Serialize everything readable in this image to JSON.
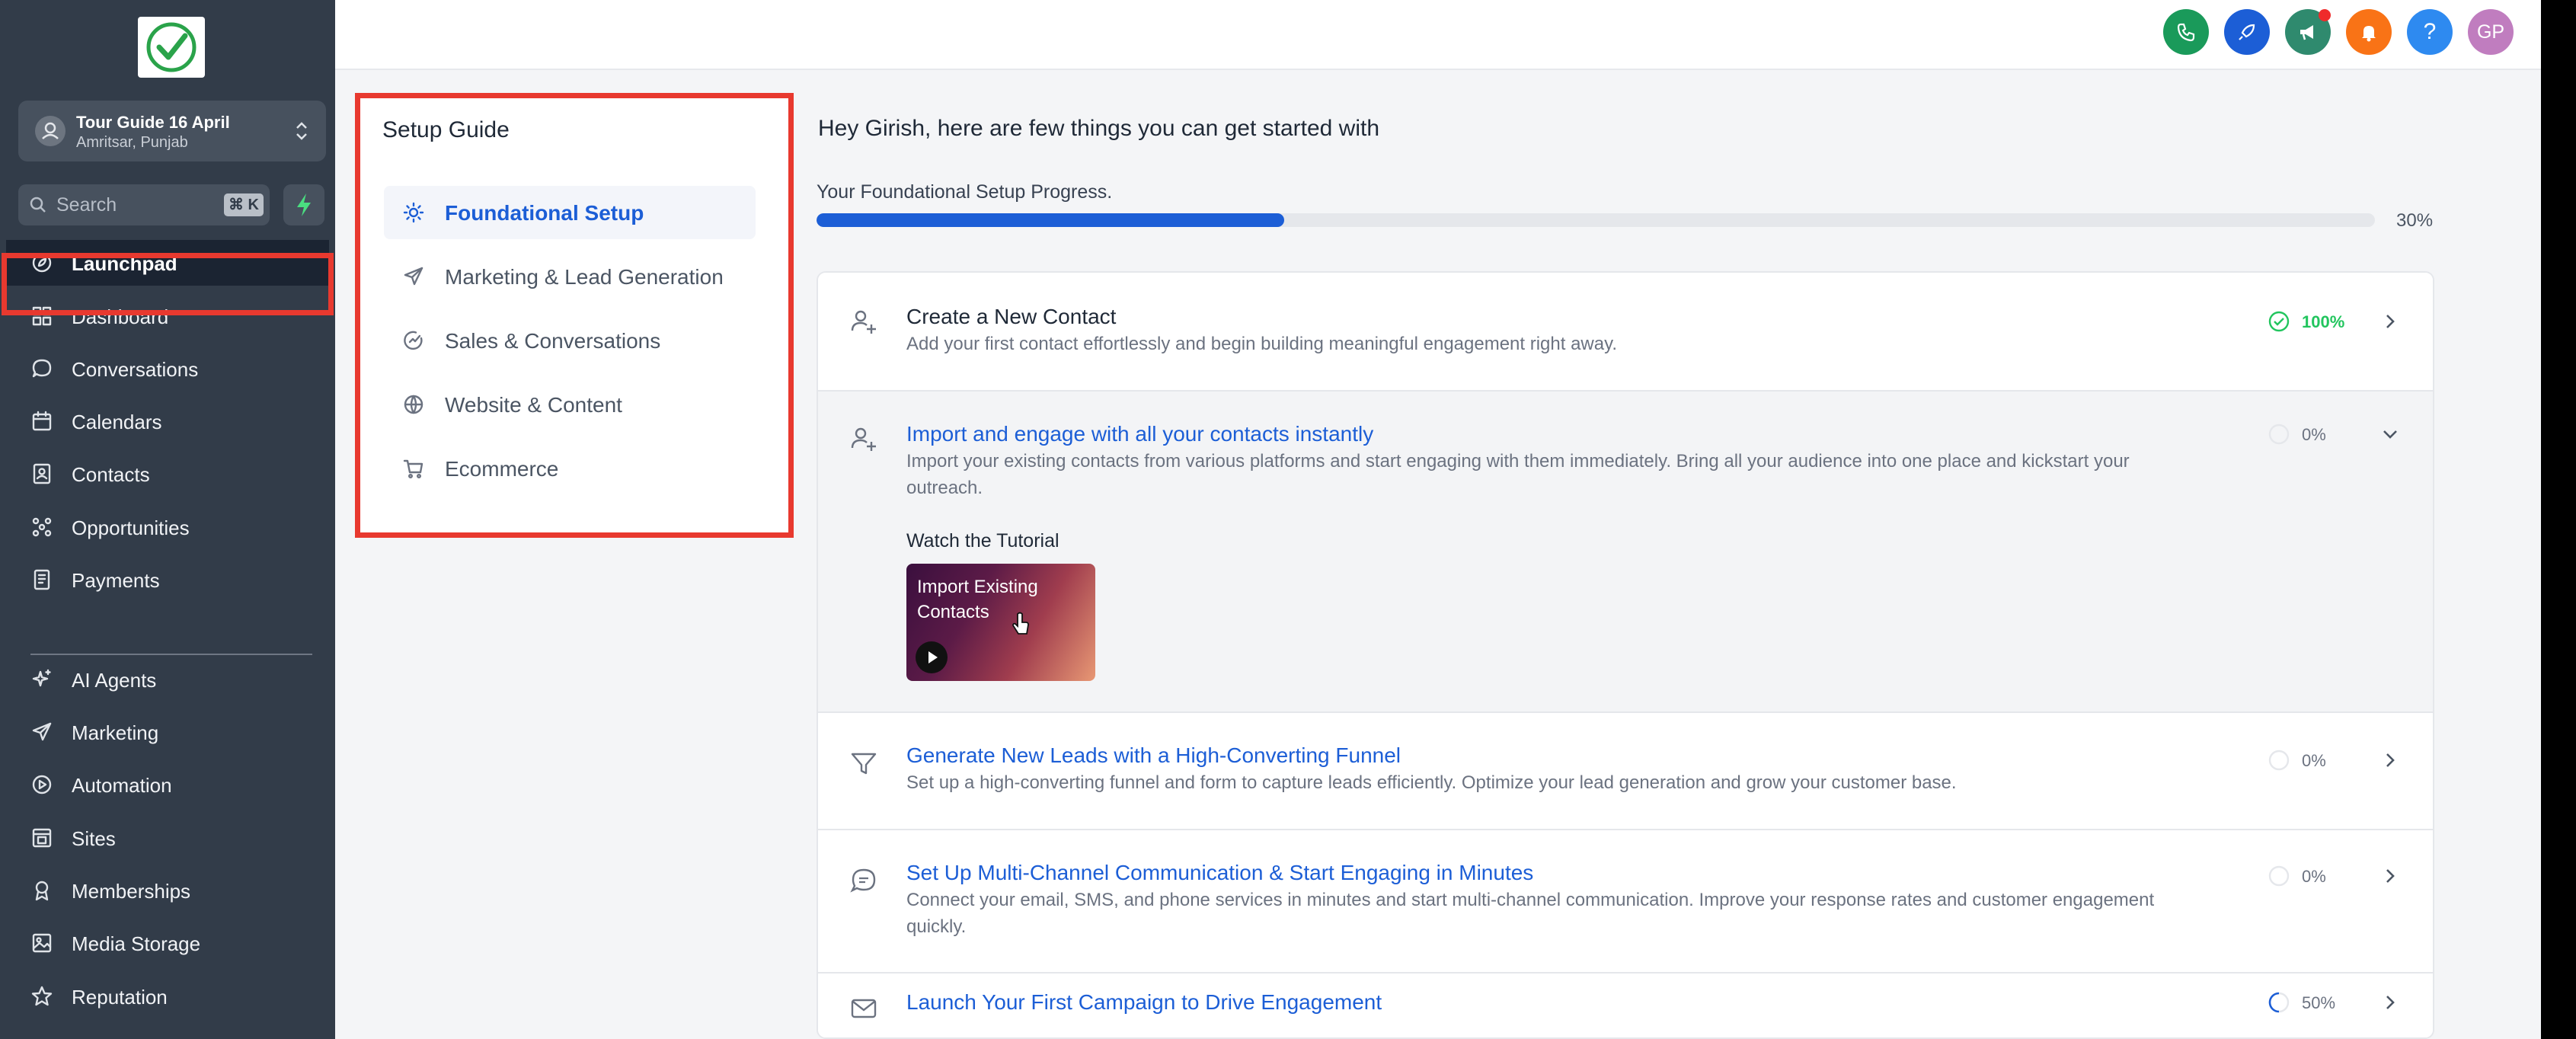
{
  "app": {
    "location_name": "Tour Guide 16 April",
    "location_address": "Amritsar, Punjab",
    "search_placeholder": "Search",
    "search_shortcut": "⌘ K"
  },
  "sidebar": {
    "items": [
      {
        "label": "Launchpad",
        "icon": "rocket-icon",
        "active": true
      },
      {
        "label": "Dashboard",
        "icon": "dashboard-icon"
      },
      {
        "label": "Conversations",
        "icon": "chat-icon"
      },
      {
        "label": "Calendars",
        "icon": "calendar-icon"
      },
      {
        "label": "Contacts",
        "icon": "contacts-icon"
      },
      {
        "label": "Opportunities",
        "icon": "opportunities-icon"
      },
      {
        "label": "Payments",
        "icon": "payments-icon"
      },
      {
        "label": "AI Agents",
        "icon": "sparkle-icon"
      },
      {
        "label": "Marketing",
        "icon": "send-icon"
      },
      {
        "label": "Automation",
        "icon": "automation-icon"
      },
      {
        "label": "Sites",
        "icon": "sites-icon"
      },
      {
        "label": "Memberships",
        "icon": "membership-icon"
      },
      {
        "label": "Media Storage",
        "icon": "image-icon"
      },
      {
        "label": "Reputation",
        "icon": "star-icon"
      }
    ]
  },
  "topbar": {
    "avatar_initials": "GP",
    "help_label": "?",
    "colors": {
      "phone": "#1a9a5a",
      "rocket": "#1c5ed6",
      "megaphone": "#2f8a6e",
      "bell": "#f97316",
      "help": "#2e8af0",
      "avatar": "#c07dbf"
    }
  },
  "setup_guide": {
    "title": "Setup Guide",
    "items": [
      {
        "label": "Foundational Setup",
        "icon": "sun-icon",
        "active": true
      },
      {
        "label": "Marketing & Lead Generation",
        "icon": "send-icon"
      },
      {
        "label": "Sales & Conversations",
        "icon": "sales-icon"
      },
      {
        "label": "Website & Content",
        "icon": "globe-icon"
      },
      {
        "label": "Ecommerce",
        "icon": "cart-icon"
      }
    ]
  },
  "main": {
    "greeting": "Hey Girish, here are few things you can get started with",
    "progress_label": "Your Foundational Setup Progress.",
    "progress_value": 0.3,
    "progress_pct": "30%",
    "tasks": [
      {
        "title": "Create a New Contact",
        "desc": "Add your first contact effortlessly and begin building meaningful engagement right away.",
        "pct": "100%",
        "status": "complete"
      },
      {
        "title": "Import and engage with all your contacts instantly",
        "desc": "Import your existing contacts from various platforms and start engaging with them immediately. Bring all your audience into one place and kickstart your outreach.",
        "pct": "0%",
        "status": "expanded",
        "watch_label": "Watch the Tutorial",
        "video_title": "Import Existing Contacts"
      },
      {
        "title": "Generate New Leads with a High-Converting Funnel",
        "desc": "Set up a high-converting funnel and form to capture leads efficiently. Optimize your lead generation and grow your customer base.",
        "pct": "0%"
      },
      {
        "title": "Set Up Multi-Channel Communication & Start Engaging in Minutes",
        "desc": "Connect your email, SMS, and phone services in minutes and start multi-channel communication. Improve your response rates and customer engagement quickly.",
        "pct": "0%"
      },
      {
        "title": "Launch Your First Campaign to Drive Engagement",
        "desc": "",
        "pct": "50%",
        "progress": 0.5
      }
    ]
  }
}
